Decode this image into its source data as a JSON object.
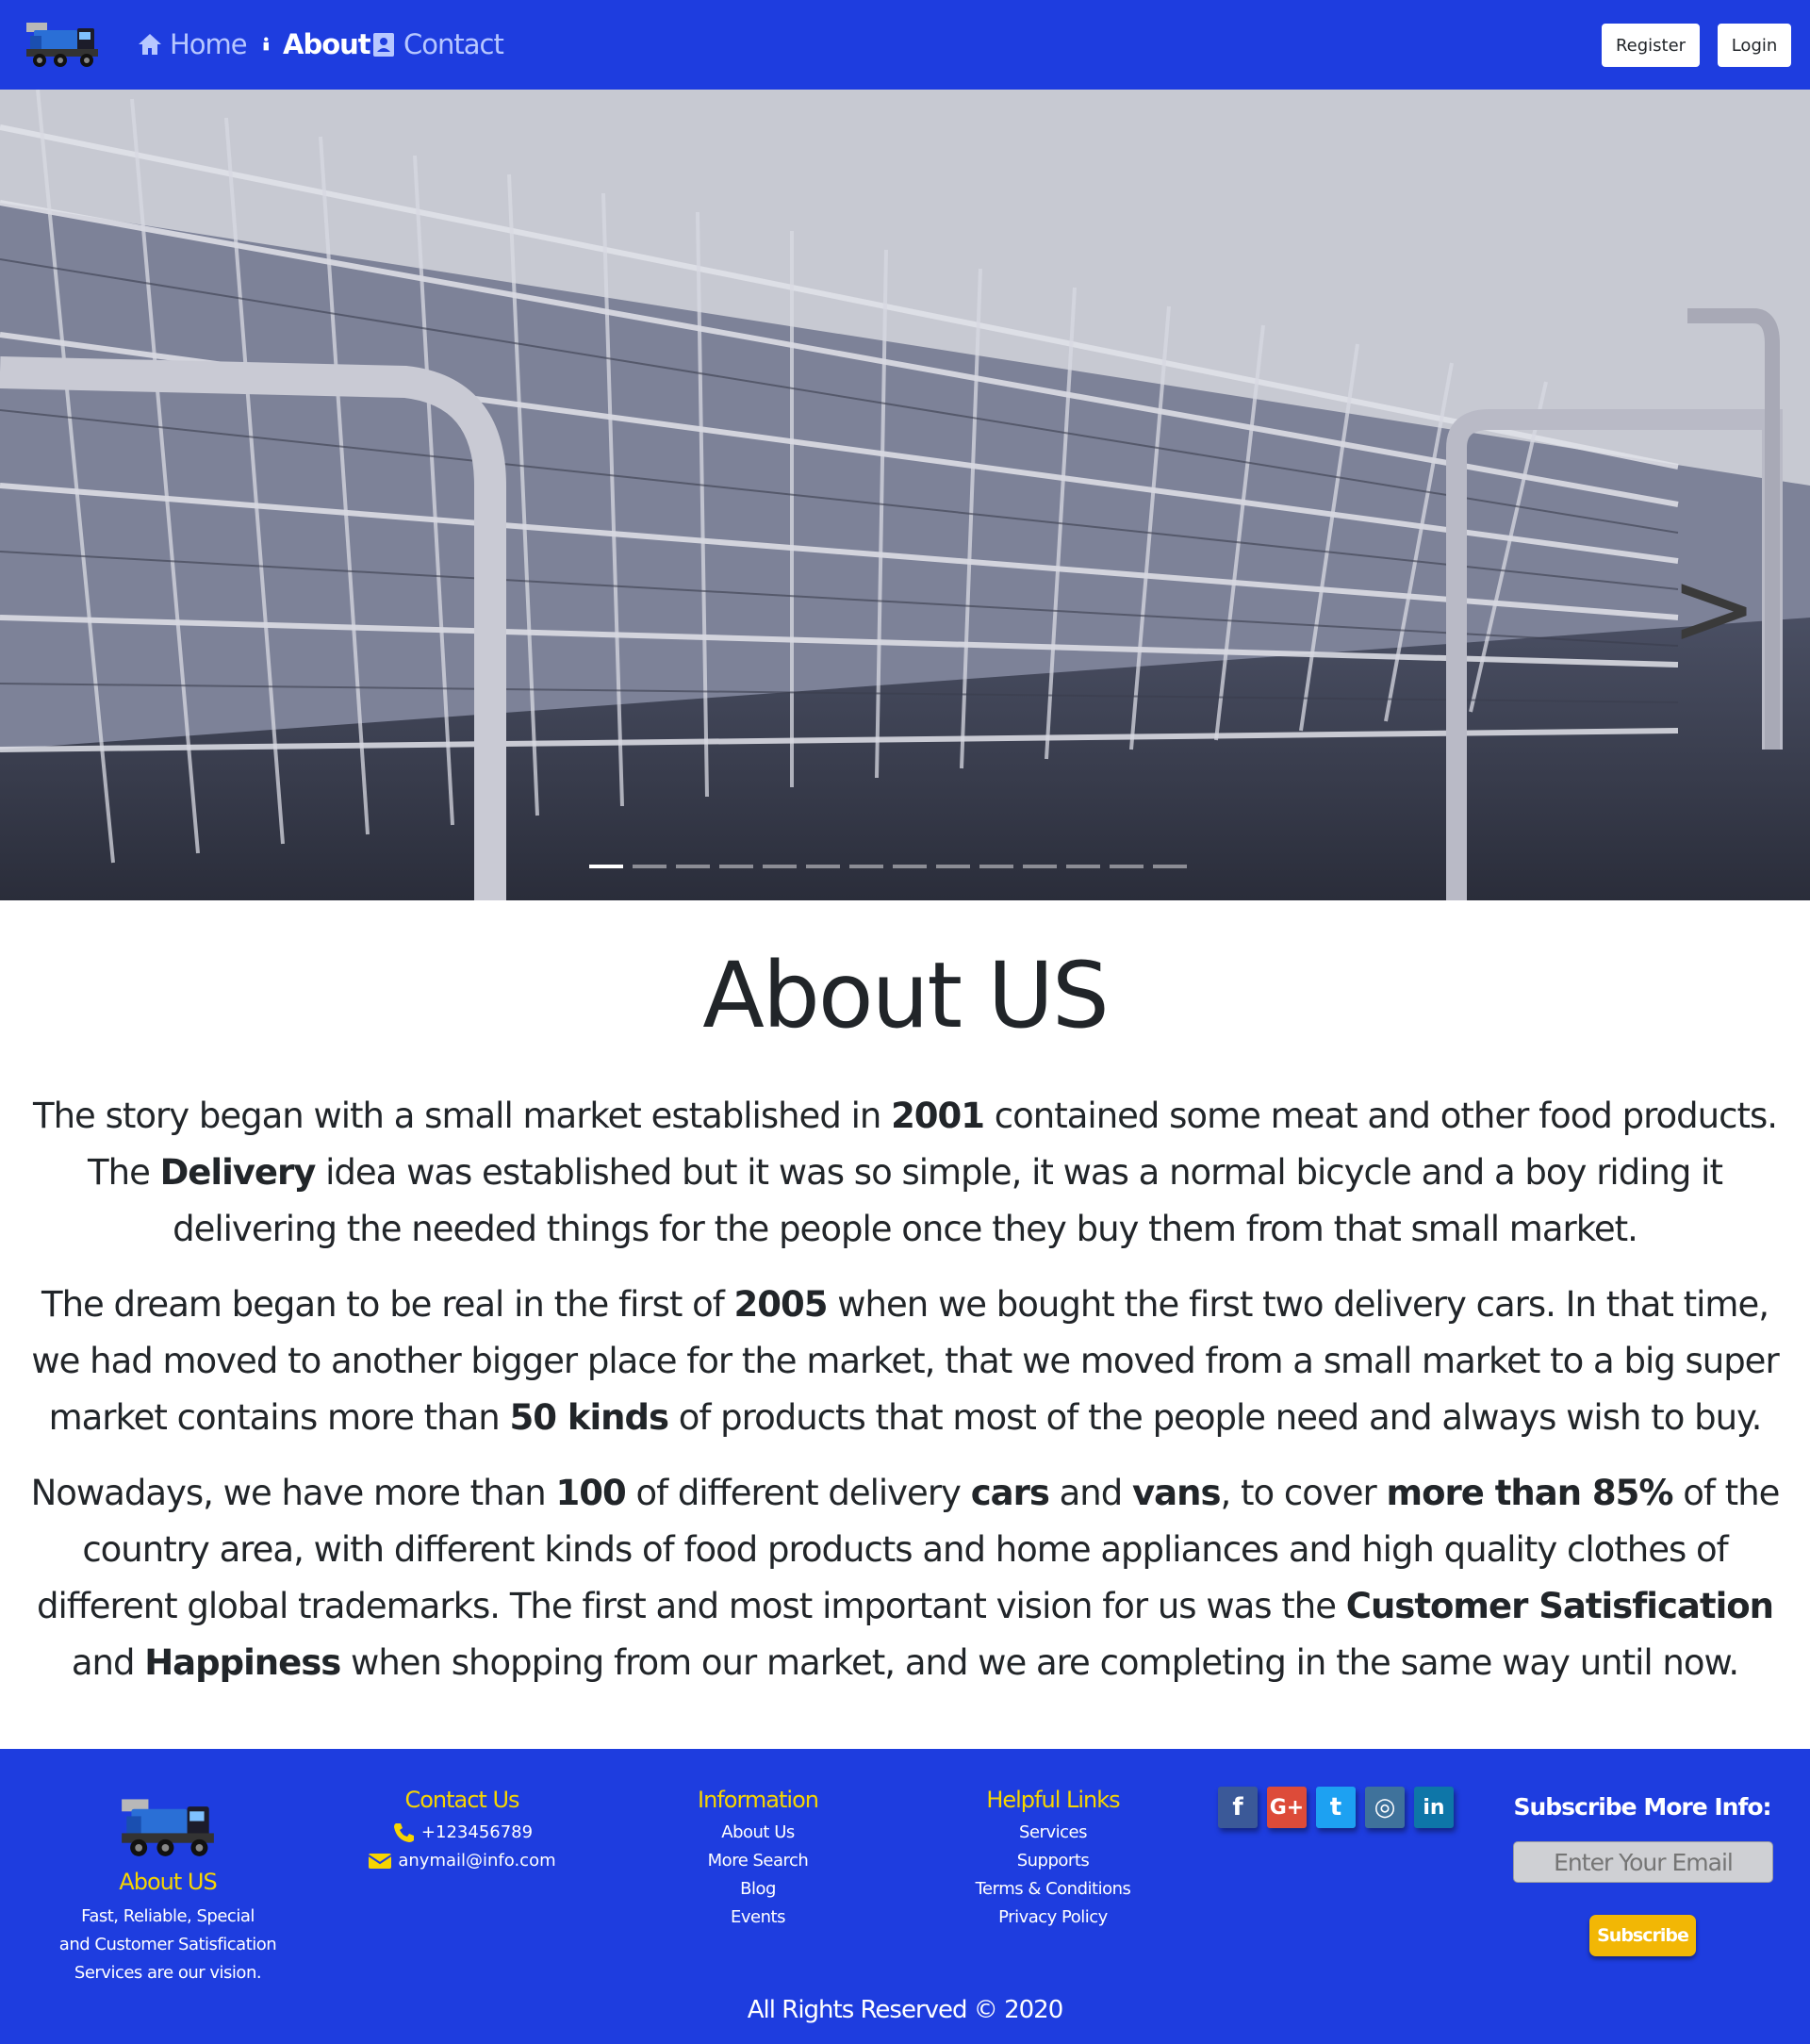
{
  "nav": {
    "links": [
      {
        "label": "Home",
        "icon": "home-icon"
      },
      {
        "label": "About",
        "icon": "info-icon"
      },
      {
        "label": "Contact",
        "icon": "contact-card-icon"
      }
    ],
    "register_label": "Register",
    "login_label": "Login"
  },
  "hero": {
    "next_label": ">",
    "slide_count": 14,
    "active_slide": 1
  },
  "about": {
    "title": "About US",
    "p1": {
      "t1": "The story began with a small market established in ",
      "b1": "2001",
      "t2": " contained some meat and other food products. The ",
      "b2": "Delivery",
      "t3": " idea was established but it was so simple, it was a normal bicycle and a boy riding it delivering the needed things for the people once they buy them from that small market."
    },
    "p2": {
      "t1": "The dream began to be real in the first of ",
      "b1": "2005",
      "t2": " when we bought the first two delivery cars. In that time, we had moved to another bigger place for the market, that we moved from a small market to a big super market contains more than ",
      "b2": "50 kinds",
      "t3": " of products that most of the people need and always wish to buy."
    },
    "p3": {
      "t1": "Nowadays, we have more than ",
      "b1": "100",
      "t2": " of different delivery ",
      "b2": "cars",
      "t3": " and ",
      "b3": "vans",
      "t4": ", to cover ",
      "b4": "more than 85%",
      "t5": " of the country area, with different kinds of food products and home appliances and high quality clothes of different global trademarks. The first and most important vision for us was the ",
      "b5": "Customer Satisfication",
      "t6": " and ",
      "b6": "Happiness",
      "t7": " when shopping from our market, and we are completing in the same way until now."
    }
  },
  "footer": {
    "about": {
      "title": "About US",
      "lines": [
        "Fast, Reliable, Special",
        "and Customer Satisfication",
        "Services are our vision."
      ]
    },
    "contact": {
      "title": "Contact Us",
      "phone": "+123456789",
      "email": "anymail@info.com"
    },
    "information": {
      "title": "Information",
      "links": [
        "About Us",
        "More Search",
        "Blog",
        "Events"
      ]
    },
    "helpful": {
      "title": "Helpful Links",
      "links": [
        "Services",
        "Supports",
        "Terms & Conditions",
        "Privacy Policy"
      ]
    },
    "socials": [
      {
        "icon": "facebook-icon",
        "glyph": "f",
        "color": "#3b5998"
      },
      {
        "icon": "google-plus-icon",
        "glyph": "G+",
        "color": "#dd4b39"
      },
      {
        "icon": "twitter-icon",
        "glyph": "t",
        "color": "#1da1f2"
      },
      {
        "icon": "instagram-icon",
        "glyph": "◎",
        "color": "#3f729b"
      },
      {
        "icon": "linkedin-icon",
        "glyph": "in",
        "color": "#0e76a8"
      }
    ],
    "subscribe": {
      "title": "Subscribe More Info:",
      "placeholder": "Enter Your Email",
      "button": "Subscribe"
    },
    "copyright": "All Rights Reserved © 2020"
  },
  "colors": {
    "brand_blue": "#1e3ddf",
    "accent_yellow": "#f7d500",
    "subscribe_button": "#f2b705"
  }
}
